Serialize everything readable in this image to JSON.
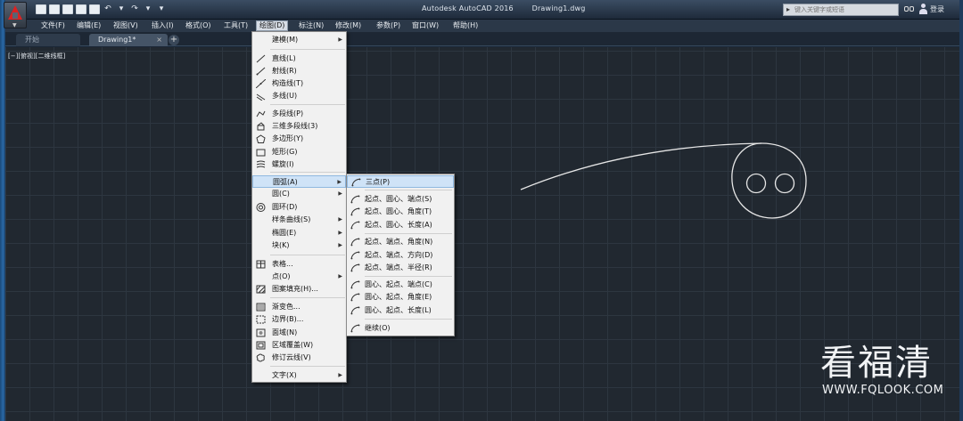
{
  "window": {
    "title_app": "Autodesk AutoCAD 2016",
    "title_doc": "Drawing1.dwg",
    "search_placeholder": "键入关键字或短语",
    "login": "登录"
  },
  "menubar": [
    {
      "label": "文件(F)"
    },
    {
      "label": "编辑(E)"
    },
    {
      "label": "视图(V)"
    },
    {
      "label": "插入(I)"
    },
    {
      "label": "格式(O)"
    },
    {
      "label": "工具(T)"
    },
    {
      "label": "绘图(D)",
      "active": true
    },
    {
      "label": "标注(N)"
    },
    {
      "label": "修改(M)"
    },
    {
      "label": "参数(P)"
    },
    {
      "label": "窗口(W)"
    },
    {
      "label": "帮助(H)"
    }
  ],
  "tabs": {
    "start": "开始",
    "doc": "Drawing1*",
    "add": "+"
  },
  "viewport_label": "[−][俯视][二维线框]",
  "draw_menu": [
    {
      "label": "建模(M)",
      "icon": "none",
      "submenu": true
    },
    {
      "label": "直线(L)",
      "icon": "line-icon"
    },
    {
      "label": "射线(R)",
      "icon": "ray-icon"
    },
    {
      "label": "构造线(T)",
      "icon": "xline-icon"
    },
    {
      "label": "多线(U)",
      "icon": "mline-icon"
    },
    {
      "label": "多段线(P)",
      "icon": "pline-icon"
    },
    {
      "label": "三维多段线(3)",
      "icon": "3dpoly-icon"
    },
    {
      "label": "多边形(Y)",
      "icon": "polygon-icon"
    },
    {
      "label": "矩形(G)",
      "icon": "rectangle-icon"
    },
    {
      "label": "螺旋(I)",
      "icon": "helix-icon"
    },
    {
      "label": "圆弧(A)",
      "icon": "none",
      "submenu": true,
      "highlight": true
    },
    {
      "label": "圆(C)",
      "icon": "none",
      "submenu": true
    },
    {
      "label": "圆环(D)",
      "icon": "donut-icon"
    },
    {
      "label": "样条曲线(S)",
      "icon": "none",
      "submenu": true
    },
    {
      "label": "椭圆(E)",
      "icon": "none",
      "submenu": true
    },
    {
      "label": "块(K)",
      "icon": "none",
      "submenu": true
    },
    {
      "label": "表格...",
      "icon": "table-icon"
    },
    {
      "label": "点(O)",
      "icon": "none",
      "submenu": true
    },
    {
      "label": "图案填充(H)...",
      "icon": "hatch-icon"
    },
    {
      "label": "渐变色...",
      "icon": "gradient-icon"
    },
    {
      "label": "边界(B)...",
      "icon": "boundary-icon"
    },
    {
      "label": "面域(N)",
      "icon": "region-icon"
    },
    {
      "label": "区域覆盖(W)",
      "icon": "wipeout-icon"
    },
    {
      "label": "修订云线(V)",
      "icon": "revcloud-icon"
    },
    {
      "label": "文字(X)",
      "icon": "none",
      "submenu": true
    }
  ],
  "arc_menu": [
    {
      "label": "三点(P)"
    },
    {
      "label": "起点、圆心、端点(S)"
    },
    {
      "label": "起点、圆心、角度(T)"
    },
    {
      "label": "起点、圆心、长度(A)"
    },
    {
      "label": "起点、端点、角度(N)"
    },
    {
      "label": "起点、端点、方向(D)"
    },
    {
      "label": "起点、端点、半径(R)"
    },
    {
      "label": "圆心、起点、端点(C)"
    },
    {
      "label": "圆心、起点、角度(E)"
    },
    {
      "label": "圆心、起点、长度(L)"
    },
    {
      "label": "继续(O)"
    }
  ],
  "watermark": {
    "big": "看福清",
    "small": "WWW.FQLOOK.COM"
  },
  "colors": {
    "canvas": "#212830",
    "grid": "#2d3640",
    "menu_bg": "#f1f1f1",
    "highlight": "#cfe3f7",
    "logo": "#dd2222"
  }
}
